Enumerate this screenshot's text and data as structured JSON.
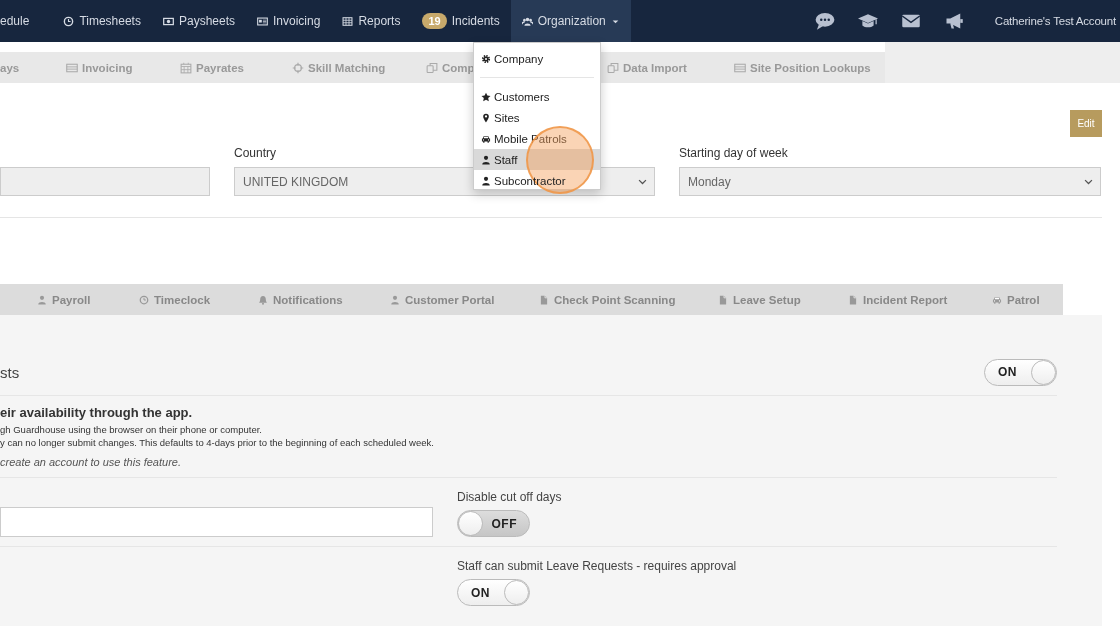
{
  "top_nav": {
    "items": [
      {
        "label": "edule",
        "selected": false
      },
      {
        "label": "Timesheets",
        "selected": false
      },
      {
        "label": "Paysheets",
        "selected": false
      },
      {
        "label": "Invoicing",
        "selected": false
      },
      {
        "label": "Reports",
        "selected": false
      },
      {
        "label": "Incidents",
        "badge": "19",
        "selected": false
      },
      {
        "label": "Organization",
        "selected": true,
        "expanded": true
      }
    ],
    "account": "Catherine's Test Account"
  },
  "sub_nav": {
    "items": [
      {
        "label": "ays"
      },
      {
        "label": "Invoicing"
      },
      {
        "label": "Payrates"
      },
      {
        "label": "Skill Matching"
      },
      {
        "label": "Comp"
      },
      {
        "label": "Data Import"
      },
      {
        "label": "Site Position Lookups"
      }
    ]
  },
  "organization_menu": {
    "items": [
      {
        "kind": "link",
        "label": "Company",
        "selected": false,
        "marked": false
      },
      {
        "kind": "divider"
      },
      {
        "kind": "link",
        "label": "Customers",
        "selected": false,
        "marked": false
      },
      {
        "kind": "link",
        "label": "Sites",
        "selected": false,
        "marked": false
      },
      {
        "kind": "link",
        "label": "Mobile Patrols",
        "selected": false,
        "marked": false
      },
      {
        "kind": "link",
        "label": "Staff",
        "selected": true,
        "marked": true
      },
      {
        "kind": "link",
        "label": "Subcontractor",
        "selected": false,
        "marked": false
      }
    ]
  },
  "edit_button": "Edit",
  "settings_form": {
    "fields": [
      {
        "kind": "input"
      },
      {
        "kind": "select",
        "label": "Country",
        "value": "UNITED KINGDOM"
      },
      {
        "kind": "select",
        "label": "Starting day of week",
        "value": "Monday"
      }
    ]
  },
  "settings_tabs": [
    {
      "label": "Payroll",
      "selected": false
    },
    {
      "label": "Timeclock",
      "selected": false
    },
    {
      "label": "Notifications",
      "selected": false
    },
    {
      "label": "Customer Portal",
      "selected": false
    },
    {
      "label": "Check Point Scanning",
      "selected": false
    },
    {
      "label": "Leave Setup",
      "selected": false
    },
    {
      "label": "Incident Report",
      "selected": false
    },
    {
      "label": "Patrol",
      "selected": false
    }
  ],
  "section": {
    "title": "sts",
    "toggle": {
      "on": true,
      "text": "ON"
    },
    "heading": "eir availability through the app.",
    "lines": [
      "gh Guardhouse using the browser on their phone or computer.",
      "y can no longer submit changes. This defaults to 4-days prior to the beginning of each scheduled week."
    ],
    "note": "create an account to use this feature.",
    "rows": [
      {
        "left": {
          "kind": "input"
        },
        "right": {
          "label": "Disable cut off days",
          "on": false,
          "text": "OFF"
        }
      },
      {
        "right": {
          "label": "Staff can submit Leave Requests - requires approval",
          "on": true,
          "text": "ON"
        }
      }
    ]
  }
}
